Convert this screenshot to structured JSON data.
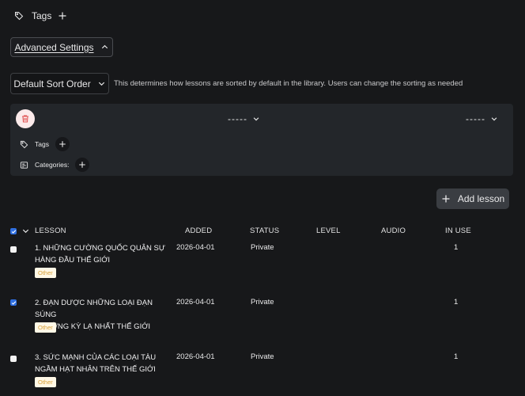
{
  "tags_section": {
    "label": "Tags"
  },
  "advanced": {
    "label": "Advanced Settings"
  },
  "sort": {
    "label": "Default Sort Order",
    "description": "This determines how lessons are sorted by default in the library. Users can change the sorting as needed"
  },
  "filters": {
    "select_1": "-----",
    "select_2": "-----",
    "tags_label": "Tags",
    "categories_label": "Categories:"
  },
  "add_lesson": {
    "label": "Add lesson"
  },
  "table": {
    "columns": {
      "lesson": "LESSON",
      "added": "ADDED",
      "status": "STATUS",
      "level": "LEVEL",
      "audio": "AUDIO",
      "in_use": "IN USE"
    },
    "rows": [
      {
        "title_line1": "1. NHỮNG CƯỜNG QUỐC QUÂN SỰ",
        "title_line2": "HÀNG ĐẦU THẾ GIỚI",
        "tag": "Other",
        "added": "2026-04-01",
        "status": "Private",
        "in_use": "1",
        "checked": false
      },
      {
        "title_line1": "2. ĐẠN DƯỢC NHỮNG LOẠI ĐẠN SÚNG",
        "title_line2": "TRƯỜNG KỲ LẠ NHẤT THẾ GIỚI",
        "tag": "Other",
        "added": "2026-04-01",
        "status": "Private",
        "in_use": "1",
        "checked": true
      },
      {
        "title_line1": "3. SỨC MẠNH CỦA CÁC LOẠI TÀU",
        "title_line2": "NGẦM HẠT NHÂN TRÊN THẾ GIỚI",
        "tag": "Other",
        "added": "2026-04-01",
        "status": "Private",
        "in_use": "1",
        "checked": false
      }
    ]
  },
  "colors": {
    "background": "#17181a",
    "panel": "#23262a",
    "badge_text": "#d8a13a",
    "checkbox_on": "#2f6fe0",
    "trash": "#e05555"
  }
}
